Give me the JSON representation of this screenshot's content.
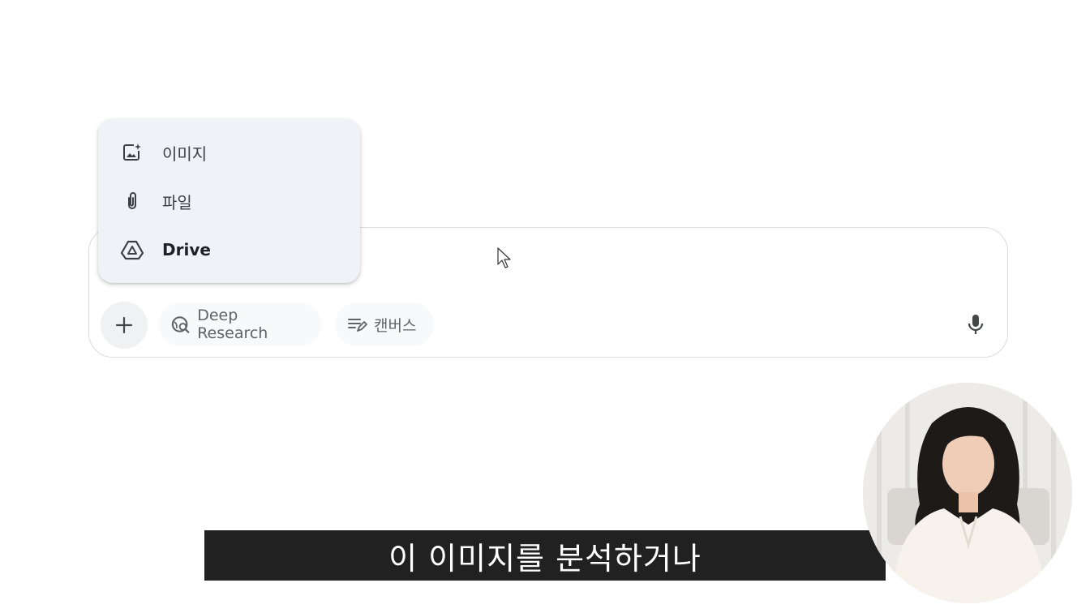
{
  "menu": {
    "items": [
      {
        "label": "이미지",
        "icon": "add-image-icon"
      },
      {
        "label": "파일",
        "icon": "paperclip-icon"
      },
      {
        "label": "Drive",
        "icon": "google-drive-icon"
      }
    ]
  },
  "prompt": {
    "plus_icon": "plus-icon",
    "tools": [
      {
        "label": "Deep Research",
        "icon": "deep-research-icon"
      },
      {
        "label": "캔버스",
        "icon": "canvas-icon"
      }
    ],
    "mic_icon": "microphone-icon"
  },
  "subtitle": {
    "text": "이 이미지를 분석하거나"
  },
  "colors": {
    "menu_bg": "#eff2f7",
    "chip_bg": "#f8f9fb",
    "subtitle_bg": "#212121",
    "border": "#dadce0"
  }
}
